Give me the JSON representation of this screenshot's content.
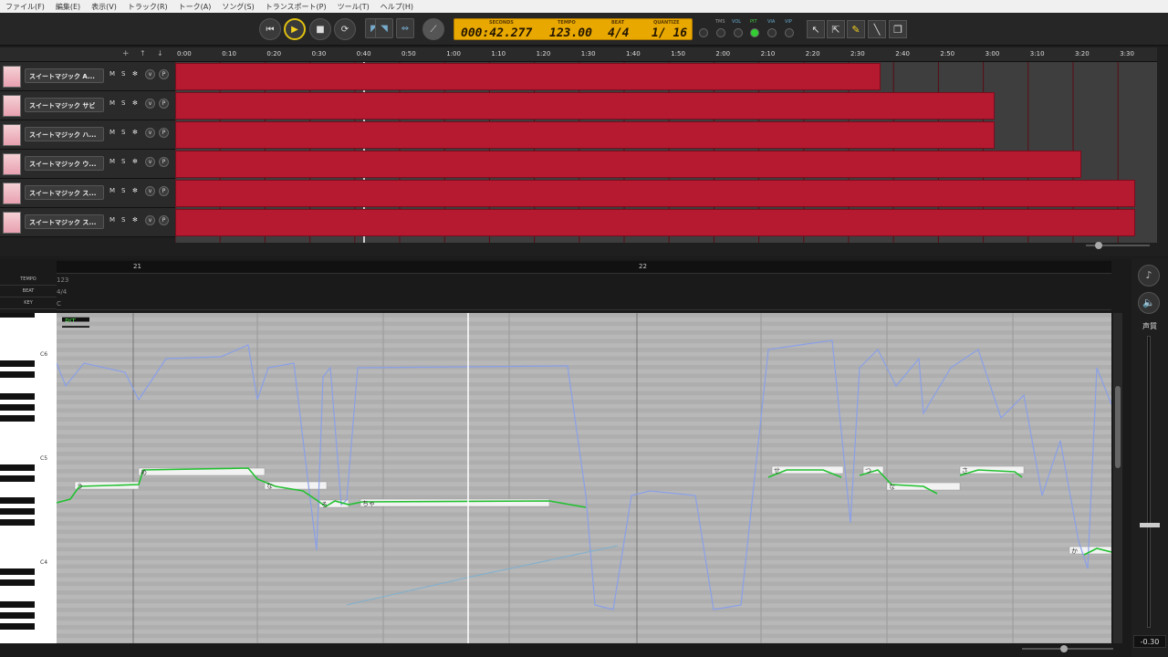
{
  "menu": [
    "ファイル(F)",
    "編集(E)",
    "表示(V)",
    "トラック(R)",
    "トーク(A)",
    "ソング(S)",
    "トランスポート(P)",
    "ツール(T)",
    "ヘルプ(H)"
  ],
  "transport": {
    "seconds_label": "SECONDS",
    "tempo_label": "TEMPO",
    "beat_label": "BEAT",
    "quantize_label": "QUANTIZE",
    "seconds": "000:42.277",
    "tempo": "123.00",
    "beat": "4/4",
    "quantize": "1/ 16"
  },
  "meters": [
    "TMS",
    "VOL",
    "PIT",
    "VIA",
    "VIP"
  ],
  "ruler_ticks": [
    "0:00",
    "0:10",
    "0:20",
    "0:30",
    "0:40",
    "0:50",
    "1:00",
    "1:10",
    "1:20",
    "1:30",
    "1:40",
    "1:50",
    "2:00",
    "2:10",
    "2:20",
    "2:30",
    "2:40",
    "2:50",
    "3:00",
    "3:10",
    "3:20",
    "3:30"
  ],
  "tracks": [
    {
      "name": "スイートマジック A..."
    },
    {
      "name": "スイートマジック サビ"
    },
    {
      "name": "スイートマジック ハ..."
    },
    {
      "name": "スイートマジック ウ..."
    },
    {
      "name": "スイートマジック ス..."
    },
    {
      "name": "スイートマジック ス..."
    }
  ],
  "track_ctl": {
    "m": "M",
    "s": "S"
  },
  "editor": {
    "bar21": "21",
    "bar22": "22",
    "tempo_label": "TEMPO",
    "beat_label": "BEAT",
    "key_label": "KEY",
    "tempo": "123",
    "beat": "4/4",
    "key": "C",
    "mode_pit": "PIT",
    "octaves": [
      "C6",
      "C5",
      "C4"
    ],
    "lyrics": [
      "う",
      "め",
      "な",
      "ろ",
      "ちゃ",
      "せ",
      "つ",
      "な",
      "さ",
      "か"
    ]
  },
  "right": {
    "label": "声質",
    "value": "-0.30"
  },
  "colors": {
    "clip": "#b61a30",
    "pitch": "#22c030",
    "param": "#8aa0e8",
    "lcd": "#e8a800"
  }
}
